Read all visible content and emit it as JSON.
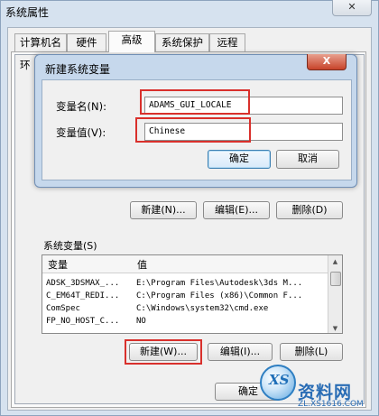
{
  "window": {
    "title": "系统属性",
    "tabs": [
      "计算机名",
      "硬件",
      "高级",
      "系统保护",
      "远程"
    ],
    "active_tab": 2,
    "env_title_fragment": "环"
  },
  "user_var_buttons": {
    "new": "新建(N)...",
    "edit": "编辑(E)...",
    "delete": "删除(D)"
  },
  "system_vars": {
    "group_label": "系统变量(S)",
    "columns": [
      "变量",
      "值"
    ],
    "rows": [
      {
        "name": "ADSK_3DSMAX_...",
        "value": "E:\\Program Files\\Autodesk\\3ds M..."
      },
      {
        "name": "C_EM64T_REDI...",
        "value": "C:\\Program Files (x86)\\Common F..."
      },
      {
        "name": "ComSpec",
        "value": "C:\\Windows\\system32\\cmd.exe"
      },
      {
        "name": "FP_NO_HOST_C...",
        "value": "NO"
      }
    ],
    "buttons": {
      "new": "新建(W)...",
      "edit": "编辑(I)...",
      "delete": "删除(L)"
    }
  },
  "bottom_buttons": {
    "ok": "确定"
  },
  "dialog": {
    "title": "新建系统变量",
    "close": "X",
    "var_name_label": "变量名(N):",
    "var_name_value": "ADAMS_GUI_LOCALE",
    "var_value_label": "变量值(V):",
    "var_value_value": "Chinese",
    "ok": "确定",
    "cancel": "取消"
  },
  "watermark": {
    "logo_letters": "XS",
    "text": "资料网",
    "url": "ZL.XS1616.COM"
  },
  "colors": {
    "highlight": "#d9302c",
    "title_bar": "#c6d8ec",
    "close_red": "#c7432a"
  }
}
